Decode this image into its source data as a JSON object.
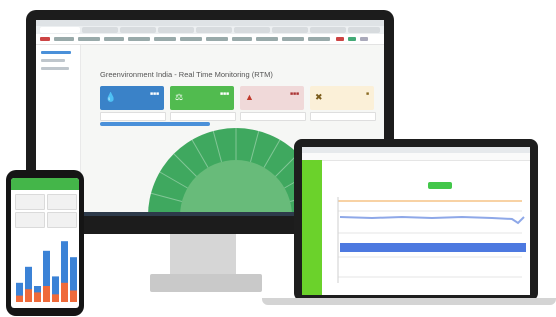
{
  "desktop": {
    "page_title": "Greenvironment India - Real Time Monitoring (RTM)",
    "kpi_cards": [
      {
        "color": "#3a82c8",
        "icon": "water-drop-icon"
      },
      {
        "color": "#51bb4f",
        "icon": "flask-icon"
      },
      {
        "color": "#f0d9d9",
        "icon": "fire-icon"
      },
      {
        "color": "#fbf0d8",
        "icon": "tools-icon"
      }
    ],
    "gauge": {
      "outer_color": "#3fa85f",
      "inner_color": "#68bb7a"
    }
  },
  "laptop": {
    "sidebar_color": "#6bd22b",
    "upper_series_color": "#8ea8e8",
    "lower_series_color": "#4d79e0"
  },
  "phone": {
    "header_color": "#44b649",
    "chart": {
      "blue_bars": [
        0.3,
        0.55,
        0.25,
        0.8,
        0.4,
        0.95,
        0.7
      ],
      "orange_bars": [
        0.1,
        0.2,
        0.15,
        0.25,
        0.12,
        0.3,
        0.18
      ],
      "blue_color": "#3b82d6",
      "orange_color": "#ef6a3a"
    }
  }
}
